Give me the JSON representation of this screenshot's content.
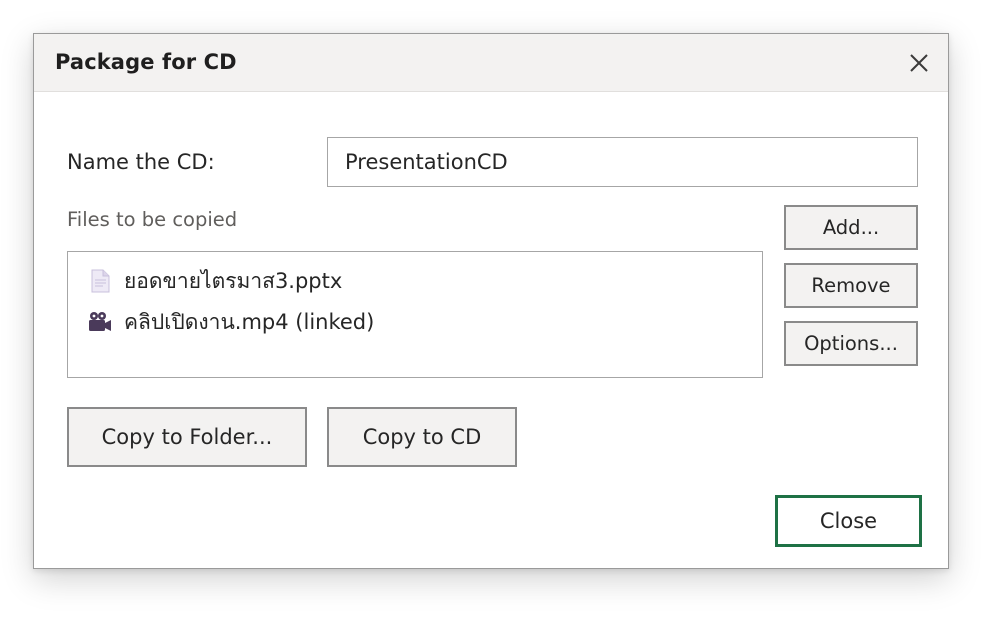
{
  "dialog": {
    "title": "Package for CD",
    "close_icon": "close-x-icon"
  },
  "name_field": {
    "label": "Name the CD:",
    "value": "PresentationCD"
  },
  "files": {
    "label": "Files to be copied",
    "items": [
      {
        "name": "ยอดขายไตรมาส3.pptx",
        "icon": "document-icon"
      },
      {
        "name": "คลิปเปิดงาน.mp4 (linked)",
        "icon": "video-camera-icon"
      }
    ]
  },
  "side_buttons": {
    "add": "Add...",
    "remove": "Remove",
    "options": "Options..."
  },
  "copy_buttons": {
    "folder": "Copy to Folder...",
    "cd": "Copy to CD"
  },
  "footer": {
    "close": "Close"
  },
  "colors": {
    "accent": "#1e7145",
    "titlebar_bg": "#f3f2f1",
    "button_bg": "#f3f2f1",
    "video_icon": "#4a3a5a",
    "document_icon": "#c8c0dc"
  }
}
